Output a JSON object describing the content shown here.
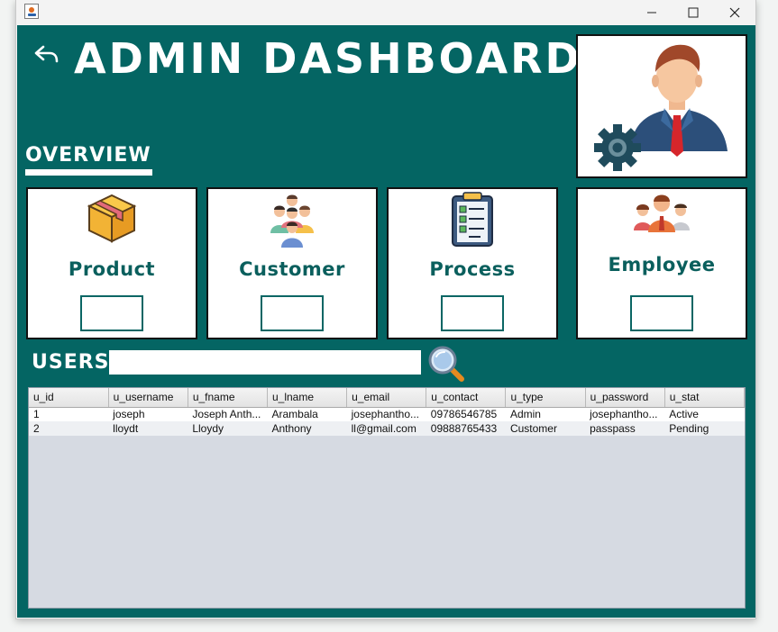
{
  "window": {
    "title": "",
    "controls": [
      "minimize",
      "maximize",
      "close"
    ]
  },
  "header": {
    "title": "ADMIN DASHBOARD",
    "back_icon": "back-arrow-icon",
    "admin_image_icon": "admin-settings-icon"
  },
  "overview": {
    "label": "OVERVIEW",
    "cards": [
      {
        "label": "Product",
        "icon": "box-icon",
        "value": ""
      },
      {
        "label": "Customer",
        "icon": "group-icon",
        "value": ""
      },
      {
        "label": "Process",
        "icon": "clipboard-checklist-icon",
        "value": ""
      },
      {
        "label": "Employee",
        "icon": "team-icon",
        "value": ""
      }
    ]
  },
  "users": {
    "label": "USERS",
    "search_value": "",
    "search_icon": "search-icon",
    "columns": [
      "u_id",
      "u_username",
      "u_fname",
      "u_lname",
      "u_email",
      "u_contact",
      "u_type",
      "u_password",
      "u_stat"
    ],
    "rows": [
      [
        "1",
        "joseph",
        "Joseph Anth...",
        "Arambala",
        "josephantho...",
        "09786546785",
        "Admin",
        "josephantho...",
        "Active"
      ],
      [
        "2",
        "lloydt",
        "Lloydy",
        "Anthony",
        "ll@gmail.com",
        "09888765433",
        "Customer",
        "passpass",
        "Pending"
      ]
    ]
  },
  "colors": {
    "background": "#046563",
    "card_text": "#0a5f5d",
    "table_bg": "#d6dae2"
  }
}
